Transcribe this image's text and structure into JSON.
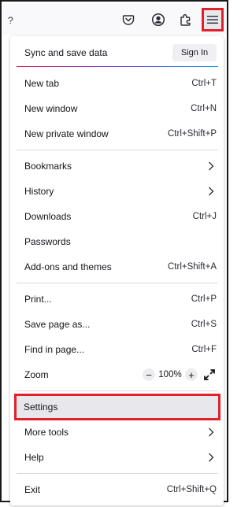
{
  "toolbar": {
    "cut_glyph": "?",
    "icons": [
      "pocket-icon",
      "account-icon",
      "extensions-icon",
      "hamburger-menu-icon"
    ]
  },
  "menu": {
    "sync": {
      "label": "Sync and save data",
      "button": "Sign In"
    },
    "new_tab": {
      "label": "New tab",
      "shortcut": "Ctrl+T"
    },
    "new_window": {
      "label": "New window",
      "shortcut": "Ctrl+N"
    },
    "new_private": {
      "label": "New private window",
      "shortcut": "Ctrl+Shift+P"
    },
    "bookmarks": {
      "label": "Bookmarks"
    },
    "history": {
      "label": "History"
    },
    "downloads": {
      "label": "Downloads",
      "shortcut": "Ctrl+J"
    },
    "passwords": {
      "label": "Passwords"
    },
    "addons": {
      "label": "Add-ons and themes",
      "shortcut": "Ctrl+Shift+A"
    },
    "print": {
      "label": "Print...",
      "shortcut": "Ctrl+P"
    },
    "save_page": {
      "label": "Save page as...",
      "shortcut": "Ctrl+S"
    },
    "find": {
      "label": "Find in page...",
      "shortcut": "Ctrl+F"
    },
    "zoom": {
      "label": "Zoom",
      "minus": "−",
      "value": "100%",
      "plus": "+"
    },
    "settings": {
      "label": "Settings"
    },
    "more_tools": {
      "label": "More tools"
    },
    "help": {
      "label": "Help"
    },
    "exit": {
      "label": "Exit",
      "shortcut": "Ctrl+Shift+Q"
    }
  },
  "colors": {
    "highlight_border": "#e0202a",
    "hover_bg": "#e8e8ec"
  }
}
